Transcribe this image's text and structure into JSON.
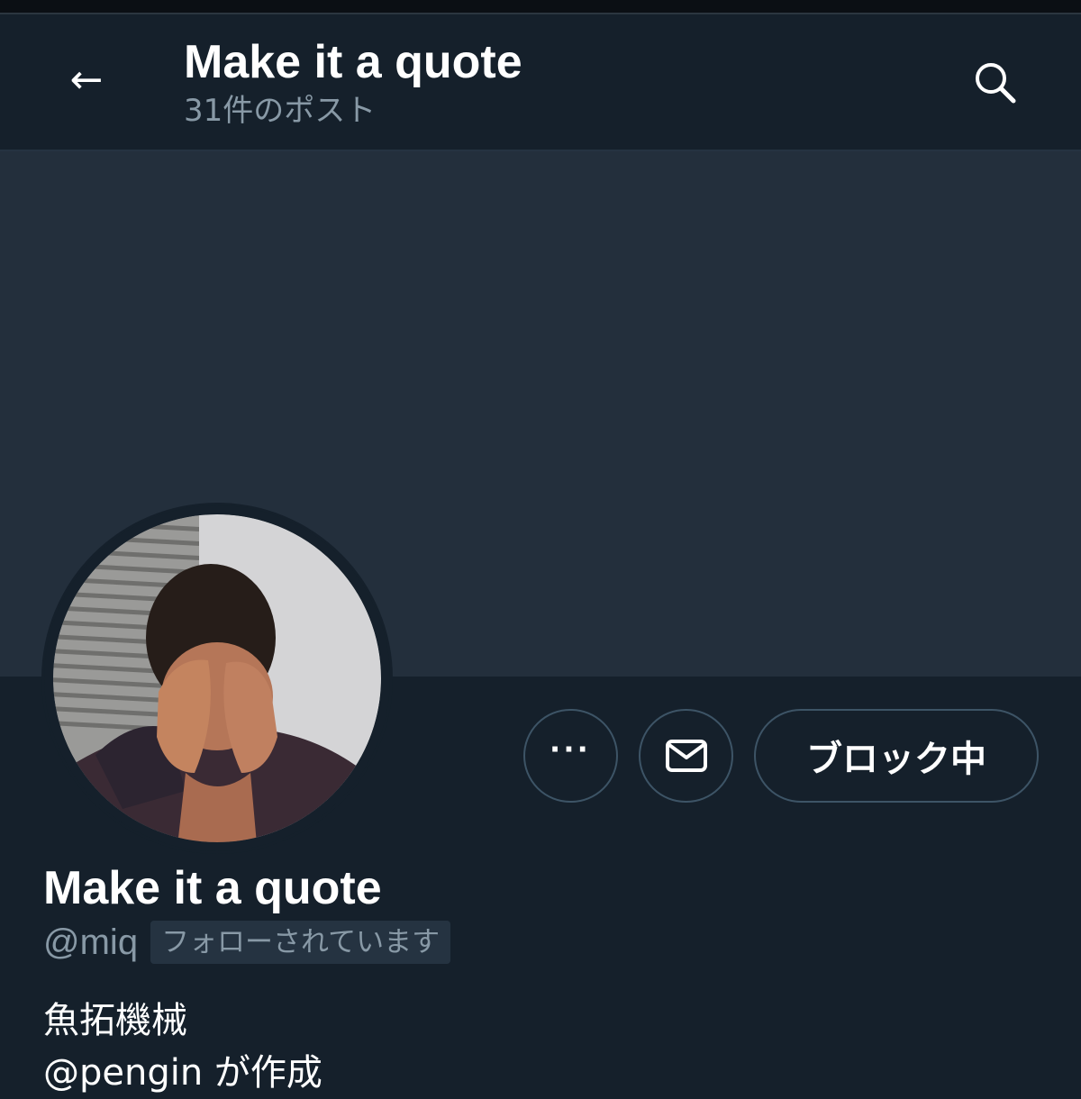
{
  "header": {
    "back_icon": "back-arrow-icon",
    "title": "Make it a quote",
    "subtitle": "31件のポスト",
    "search_icon": "search-icon"
  },
  "profile": {
    "name": "Make it a quote",
    "handle": "@miq",
    "follows_you_badge": "フォローされています",
    "bio_line1": "魚拓機械",
    "bio_line2": "@pengin が作成"
  },
  "actions": {
    "more_label": "···",
    "message_icon": "mail-icon",
    "block_label": "ブロック中"
  },
  "colors": {
    "background": "#15202b",
    "banner": "#232f3c",
    "muted_text": "#8899a6",
    "button_border": "#3d5466"
  }
}
